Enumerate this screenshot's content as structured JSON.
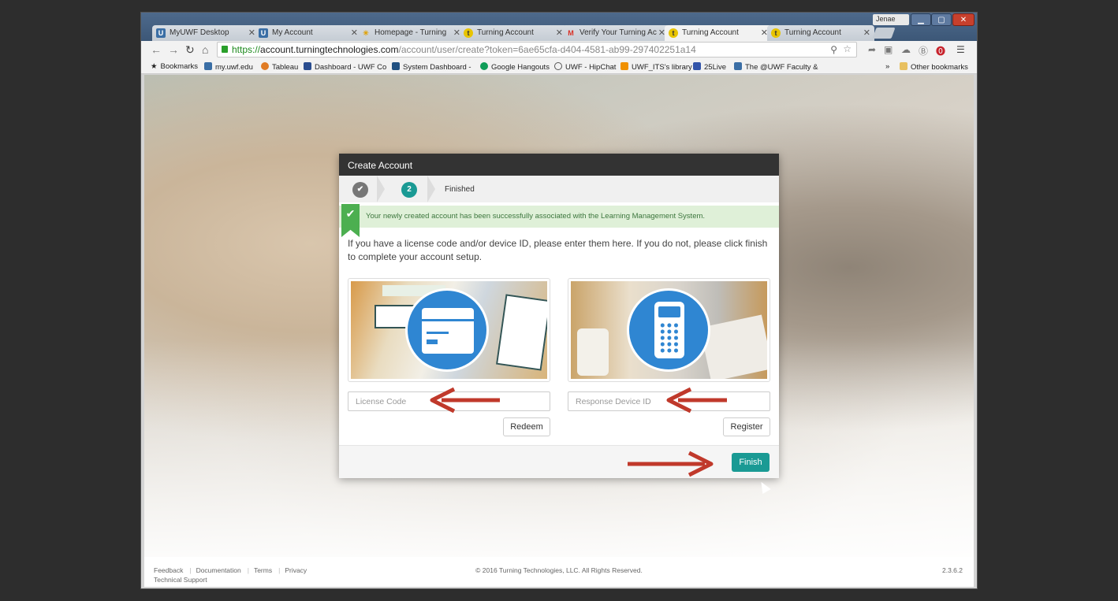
{
  "browser": {
    "tabs": [
      {
        "label": "MyUWF Desktop",
        "favicon": "uwf-icon",
        "active": false
      },
      {
        "label": "My Account",
        "favicon": "uwf-icon",
        "active": false
      },
      {
        "label": "Homepage - Turning",
        "favicon": "turning-star-icon",
        "active": false
      },
      {
        "label": "Turning Account",
        "favicon": "turning-icon",
        "active": false
      },
      {
        "label": "Verify Your Turning Ac",
        "favicon": "gmail-icon",
        "active": false
      },
      {
        "label": "Turning Account",
        "favicon": "turning-icon",
        "active": true
      },
      {
        "label": "Turning Account",
        "favicon": "turning-icon",
        "active": false
      }
    ],
    "user_badge": "Jenae",
    "url": {
      "scheme": "https://",
      "host": "account.turningtechnologies.com",
      "path": "/account/user/create?token=6ae65cfa-d404-4581-ab99-297402251a14"
    },
    "bookmarks": [
      {
        "label": "Bookmarks",
        "icon": "star-icon"
      },
      {
        "label": "my.uwf.edu",
        "icon": "uwf-icon"
      },
      {
        "label": "Tableau",
        "icon": "tableau-icon"
      },
      {
        "label": "Dashboard - UWF Co",
        "icon": "x-icon"
      },
      {
        "label": "System Dashboard - ",
        "icon": "jira-icon"
      },
      {
        "label": "Google Hangouts",
        "icon": "hangouts-icon"
      },
      {
        "label": "UWF - HipChat",
        "icon": "hipchat-icon"
      },
      {
        "label": "UWF_ITS's library",
        "icon": "rss-icon"
      },
      {
        "label": "25Live",
        "icon": "25live-icon"
      },
      {
        "label": "The @UWF Faculty &",
        "icon": "uwf-icon"
      }
    ],
    "bookmarks_overflow": "»",
    "other_bookmarks": "Other bookmarks"
  },
  "modal": {
    "title": "Create Account",
    "steps": {
      "step1_done": "✔",
      "step2": "2",
      "label": "Finished"
    },
    "alert": "Your newly created account has been successfully associated with the Learning Management System.",
    "intro": "If you have a license code and/or device ID, please enter them here. If you do not, please click finish to complete your account setup.",
    "license": {
      "placeholder": "License Code",
      "button": "Redeem"
    },
    "device": {
      "placeholder": "Response Device ID",
      "button": "Register"
    },
    "finish": "Finish"
  },
  "footer": {
    "links": [
      "Feedback",
      "Documentation",
      "Terms",
      "Privacy"
    ],
    "support": "Technical Support",
    "copyright": "© 2016 Turning Technologies, LLC. All Rights Reserved.",
    "version": "2.3.6.2"
  },
  "colors": {
    "accent": "#1a9a94",
    "success": "#4caf50",
    "arrow": "#c0392b",
    "icon_circle": "#2f86d2"
  }
}
